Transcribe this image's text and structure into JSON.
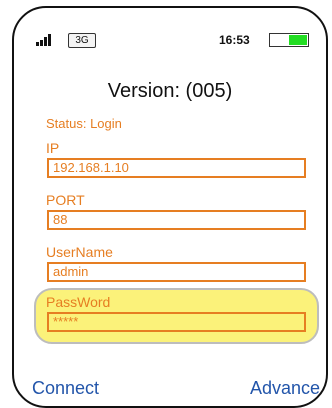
{
  "status_bar": {
    "network": "3G",
    "time": "16:53",
    "signal_icon": "signal-bars-icon",
    "battery_icon": "battery-icon",
    "battery_color": "#22dd22"
  },
  "screen": {
    "title": "Version: (005)",
    "status": "Status: Login"
  },
  "form": {
    "ip_label": "IP",
    "ip_value": "192.168.1.10",
    "port_label": "PORT",
    "port_value": "88",
    "username_label": "UserName",
    "username_value": "admin",
    "password_label": "PassWord",
    "password_value": "*****"
  },
  "actions": {
    "connect_label": "Connect",
    "advance_label": "Advance"
  },
  "colors": {
    "accent": "#e67e22",
    "link": "#2255aa",
    "highlight": "#fbf27a"
  }
}
